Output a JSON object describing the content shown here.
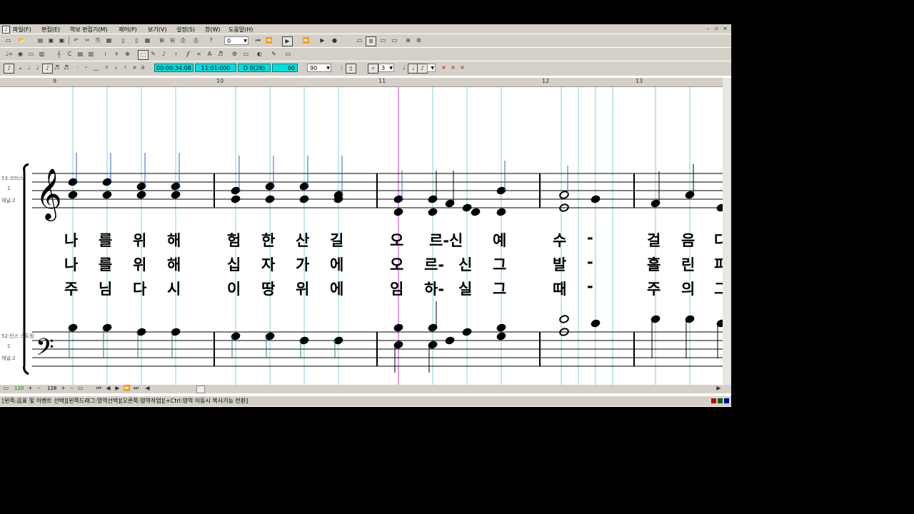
{
  "menu": [
    "파일(F)",
    "편집(E)",
    "악보 편집기(M)",
    "제어(P)",
    "보기(V)",
    "설정(S)",
    "창(W)",
    "도움말(H)"
  ],
  "toolbar": {
    "measure_combo": "0",
    "time_display": "00:00:34:08",
    "position_display": "11:01:000",
    "note_display": "D 0(26)",
    "tempo_display": "60",
    "zoom_combo": "90",
    "voice_combo": "3"
  },
  "ruler": [
    "9",
    "10",
    "11",
    "12",
    "13"
  ],
  "staves": [
    {
      "label": "53:코러스",
      "number": "1",
      "channel": "채널:2"
    },
    {
      "label": "52:인스 스트링",
      "number": "2",
      "channel": "채널:2"
    }
  ],
  "lyrics": [
    [
      "나",
      "를",
      "위",
      "해",
      "험",
      "한",
      "산",
      "길",
      "오",
      "르-신",
      "예",
      "수",
      "-",
      "걸",
      "음",
      "다"
    ],
    [
      "나",
      "를",
      "위",
      "해",
      "십",
      "자",
      "가",
      "에",
      "오",
      "르-",
      "신",
      "그",
      "발",
      "-",
      "흘",
      "린",
      "피"
    ],
    [
      "주",
      "님",
      "다",
      "시",
      "이",
      "땅",
      "위",
      "에",
      "임",
      "하-",
      "실",
      "그",
      "때",
      "-",
      "주",
      "의",
      "그"
    ]
  ],
  "hscroll": {
    "a": "120",
    "b": "128"
  },
  "status_text": "[왼쪽:음표 및 이벤트 선택][왼쪽드래그:영역선택][오른쪽:영역작업][+Ctrl:영역 이동시 복사기능 전환]"
}
